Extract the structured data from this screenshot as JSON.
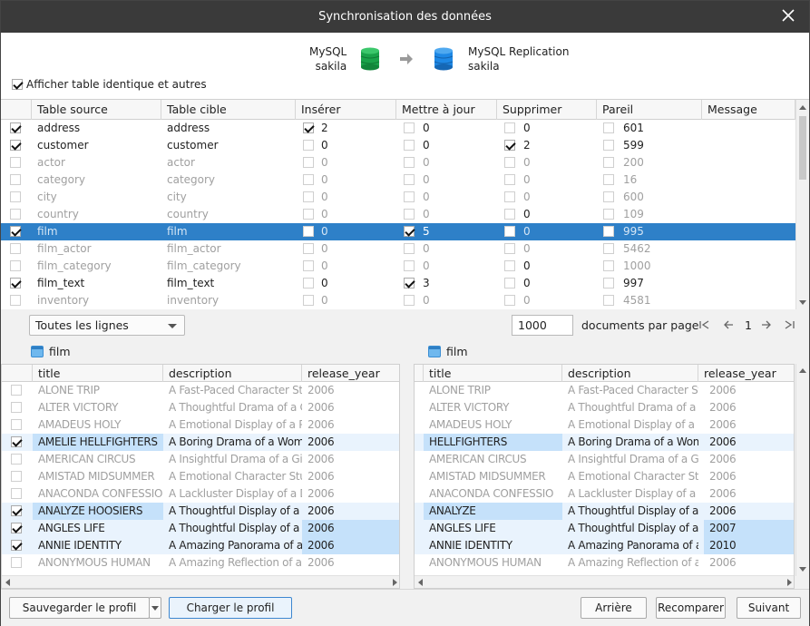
{
  "window": {
    "title": "Synchronisation des données"
  },
  "source": {
    "line1": "MySQL",
    "line2": "sakila"
  },
  "target": {
    "line1": "MySQL Replication",
    "line2": "sakila"
  },
  "show_identical": {
    "label": "Afficher table identique et autres",
    "checked": true
  },
  "top_table": {
    "columns": [
      "Table source",
      "Table cible",
      "Insérer",
      "Mettre à jour",
      "Supprimer",
      "Pareil",
      "Message"
    ],
    "rows": [
      {
        "checked": true,
        "src": "address",
        "dst": "address",
        "ins": "2",
        "ins_c": true,
        "upd": "0",
        "upd_c": false,
        "del": "0",
        "del_c": false,
        "same": "601",
        "dim": false,
        "sel": false
      },
      {
        "checked": true,
        "src": "customer",
        "dst": "customer",
        "ins": "0",
        "ins_c": false,
        "upd": "0",
        "upd_c": false,
        "del": "2",
        "del_c": true,
        "same": "599",
        "dim": false,
        "sel": false
      },
      {
        "checked": false,
        "src": "actor",
        "dst": "actor",
        "ins": "0",
        "ins_c": false,
        "upd": "0",
        "upd_c": false,
        "del": "0",
        "del_c": false,
        "same": "200",
        "dim": true,
        "sel": false
      },
      {
        "checked": false,
        "src": "category",
        "dst": "category",
        "ins": "0",
        "ins_c": false,
        "upd": "0",
        "upd_c": false,
        "del": "0",
        "del_c": false,
        "same": "16",
        "dim": true,
        "sel": false
      },
      {
        "checked": false,
        "src": "city",
        "dst": "city",
        "ins": "0",
        "ins_c": false,
        "upd": "0",
        "upd_c": false,
        "del": "0",
        "del_c": false,
        "same": "600",
        "dim": true,
        "sel": false
      },
      {
        "checked": false,
        "src": "country",
        "dst": "country",
        "ins": "0",
        "ins_c": false,
        "upd": "0",
        "upd_c": false,
        "del": "0",
        "del_c": false,
        "same": "109",
        "dim": true,
        "sel": false,
        "del_bold": true
      },
      {
        "checked": true,
        "src": "film",
        "dst": "film",
        "ins": "0",
        "ins_c": false,
        "upd": "5",
        "upd_c": true,
        "del": "0",
        "del_c": false,
        "same": "995",
        "dim": true,
        "sel": true
      },
      {
        "checked": false,
        "src": "film_actor",
        "dst": "film_actor",
        "ins": "0",
        "ins_c": false,
        "upd": "0",
        "upd_c": false,
        "del": "0",
        "del_c": false,
        "same": "5462",
        "dim": true,
        "sel": false
      },
      {
        "checked": false,
        "src": "film_category",
        "dst": "film_category",
        "ins": "0",
        "ins_c": false,
        "upd": "0",
        "upd_c": false,
        "del": "0",
        "del_c": false,
        "same": "1000",
        "dim": true,
        "sel": false,
        "del_bold": true
      },
      {
        "checked": true,
        "src": "film_text",
        "dst": "film_text",
        "ins": "0",
        "ins_c": false,
        "upd": "3",
        "upd_c": true,
        "del": "0",
        "del_c": false,
        "same": "997",
        "dim": false,
        "sel": false
      },
      {
        "checked": false,
        "src": "inventory",
        "dst": "inventory",
        "ins": "0",
        "ins_c": false,
        "upd": "0",
        "upd_c": false,
        "del": "0",
        "del_c": false,
        "same": "4581",
        "dim": true,
        "sel": false
      }
    ]
  },
  "filter": {
    "selected": "Toutes les lignes"
  },
  "paging": {
    "page_size": "1000",
    "label": "documents par page",
    "page": "1"
  },
  "left_pane": {
    "table_name": "film",
    "columns": [
      "title",
      "description",
      "release_year"
    ],
    "rows": [
      {
        "checked": false,
        "title": "ALONE TRIP",
        "desc": "A Fast-Paced Character Stuc",
        "year": "2006",
        "state": "dim"
      },
      {
        "checked": false,
        "title": "ALTER VICTORY",
        "desc": "A Thoughtful Drama of a Cc",
        "year": "2006",
        "state": "dim"
      },
      {
        "checked": false,
        "title": "AMADEUS HOLY",
        "desc": "A Emotional Display of a Pic",
        "year": "2006",
        "state": "dim"
      },
      {
        "checked": true,
        "title": "AMELIE HELLFIGHTERS",
        "desc": "A Boring Drama of a Woma",
        "year": "2006",
        "state": "diff",
        "hl": [
          "title"
        ]
      },
      {
        "checked": false,
        "title": "AMERICAN CIRCUS",
        "desc": "A Insightful Drama of a Girl",
        "year": "2006",
        "state": "dim"
      },
      {
        "checked": false,
        "title": "AMISTAD MIDSUMMER",
        "desc": "A Emotional Character Stud",
        "year": "2006",
        "state": "dim"
      },
      {
        "checked": false,
        "title": "ANACONDA CONFESSIO",
        "desc": "A Lackluster Display of a D",
        "year": "2006",
        "state": "dim"
      },
      {
        "checked": true,
        "title": "ANALYZE HOOSIERS",
        "desc": "A Thoughtful Display of a E",
        "year": "2006",
        "state": "diff",
        "hl": [
          "title"
        ]
      },
      {
        "checked": true,
        "title": "ANGLES LIFE",
        "desc": "A Thoughtful Display of a W",
        "year": "2006",
        "state": "diff",
        "hl": [
          "year"
        ]
      },
      {
        "checked": true,
        "title": "ANNIE IDENTITY",
        "desc": "A Amazing Panorama of a P",
        "year": "2006",
        "state": "diff",
        "hl": [
          "year"
        ]
      },
      {
        "checked": false,
        "title": "ANONYMOUS HUMAN",
        "desc": "A Amazing Reflection of a",
        "year": "2006",
        "state": "dim"
      }
    ]
  },
  "right_pane": {
    "table_name": "film",
    "columns": [
      "title",
      "description",
      "release_year"
    ],
    "rows": [
      {
        "title": "ALONE TRIP",
        "desc": "A Fast-Paced Character Stuc",
        "year": "2006",
        "state": "dim"
      },
      {
        "title": "ALTER VICTORY",
        "desc": "A Thoughtful Drama of a Cc",
        "year": "2006",
        "state": "dim"
      },
      {
        "title": "AMADEUS HOLY",
        "desc": "A Emotional Display of a Pic",
        "year": "2006",
        "state": "dim"
      },
      {
        "title": "HELLFIGHTERS",
        "desc": "A Boring Drama of a Woma",
        "year": "2006",
        "state": "diff",
        "hl": [
          "title"
        ]
      },
      {
        "title": "AMERICAN CIRCUS",
        "desc": "A Insightful Drama of a Girl",
        "year": "2006",
        "state": "dim"
      },
      {
        "title": "AMISTAD MIDSUMMER",
        "desc": "A Emotional Character Stud",
        "year": "2006",
        "state": "dim"
      },
      {
        "title": "ANACONDA CONFESSIO",
        "desc": "A Lackluster Display of a D",
        "year": "2006",
        "state": "dim"
      },
      {
        "title": "ANALYZE",
        "desc": "A Thoughtful Display of a E",
        "year": "2006",
        "state": "diff",
        "hl": [
          "title"
        ]
      },
      {
        "title": "ANGLES LIFE",
        "desc": "A Thoughtful Display of a W",
        "year": "2007",
        "state": "diff",
        "hl": [
          "year"
        ]
      },
      {
        "title": "ANNIE IDENTITY",
        "desc": "A Amazing Panorama of a P",
        "year": "2010",
        "state": "diff",
        "hl": [
          "year"
        ]
      },
      {
        "title": "ANONYMOUS HUMAN",
        "desc": "A Amazing Reflection of a",
        "year": "2006",
        "state": "dim"
      }
    ]
  },
  "buttons": {
    "save_profile": "Sauvegarder le profil",
    "load_profile": "Charger le profil",
    "back": "Arrière",
    "compare": "Recomparer",
    "next": "Suivant"
  },
  "colors": {
    "titlebar": "#3a3a3a",
    "selection": "#2e80c8",
    "diff_row": "#e9f3fd",
    "diff_cell": "#c5e1fa",
    "source_db": "#1aa34a",
    "target_db": "#1e88e5"
  }
}
